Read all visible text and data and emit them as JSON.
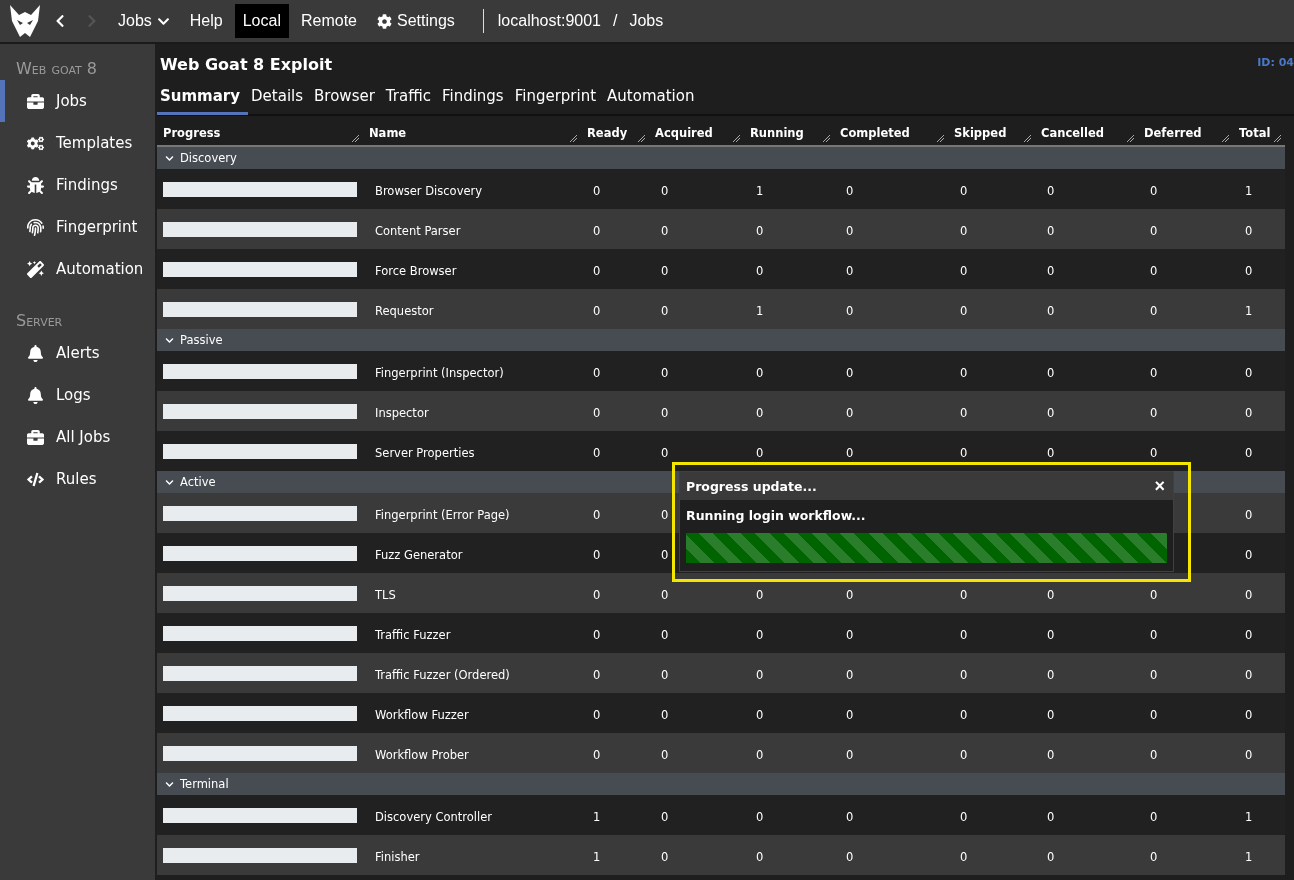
{
  "topbar": {
    "nav": [
      {
        "label": "Jobs",
        "kind": "dropdown",
        "selected": false
      },
      {
        "label": "Help",
        "kind": "plain",
        "selected": false
      },
      {
        "label": "Local",
        "kind": "plain",
        "selected": true
      },
      {
        "label": "Remote",
        "kind": "plain",
        "selected": false
      },
      {
        "label": "Settings",
        "kind": "settings",
        "selected": false
      }
    ],
    "breadcrumb": [
      "localhost:9001",
      "/",
      "Jobs"
    ]
  },
  "sidebar": {
    "sections": [
      {
        "title": "Web goat 8",
        "items": [
          {
            "label": "Jobs",
            "selected": true
          },
          {
            "label": "Templates",
            "selected": false
          },
          {
            "label": "Findings",
            "selected": false
          },
          {
            "label": "Fingerprint",
            "selected": false
          },
          {
            "label": "Automation",
            "selected": false
          }
        ]
      },
      {
        "title": "Server",
        "items": [
          {
            "label": "Alerts",
            "selected": false
          },
          {
            "label": "Logs",
            "selected": false
          },
          {
            "label": "All Jobs",
            "selected": false
          },
          {
            "label": "Rules",
            "selected": false
          }
        ]
      }
    ]
  },
  "page": {
    "title": "Web Goat 8 Exploit",
    "id": "ID: 04"
  },
  "tabs": [
    {
      "label": "Summary",
      "selected": true
    },
    {
      "label": "Details",
      "selected": false
    },
    {
      "label": "Browser",
      "selected": false
    },
    {
      "label": "Traffic",
      "selected": false
    },
    {
      "label": "Findings",
      "selected": false
    },
    {
      "label": "Fingerprint",
      "selected": false
    },
    {
      "label": "Automation",
      "selected": false
    }
  ],
  "table": {
    "columns": [
      "Progress",
      "Name",
      "Ready",
      "Acquired",
      "Running",
      "Completed",
      "Skipped",
      "Cancelled",
      "Deferred",
      "Total"
    ],
    "groups": [
      {
        "title": "Discovery",
        "rows": [
          {
            "level": 0,
            "name": "Browser Discovery",
            "ready": "0",
            "acquired": "0",
            "running": "1",
            "completed": "0",
            "skipped": "0",
            "cancelled": "0",
            "deferred": "0",
            "total": "1"
          },
          {
            "level": 0,
            "name": "Content Parser",
            "ready": "0",
            "acquired": "0",
            "running": "0",
            "completed": "0",
            "skipped": "0",
            "cancelled": "0",
            "deferred": "0",
            "total": "0"
          },
          {
            "level": 0,
            "name": "Force Browser",
            "ready": "0",
            "acquired": "0",
            "running": "0",
            "completed": "0",
            "skipped": "0",
            "cancelled": "0",
            "deferred": "0",
            "total": "0"
          },
          {
            "level": 0,
            "name": "Requestor",
            "ready": "0",
            "acquired": "0",
            "running": "1",
            "completed": "0",
            "skipped": "0",
            "cancelled": "0",
            "deferred": "0",
            "total": "1"
          }
        ]
      },
      {
        "title": "Passive",
        "rows": [
          {
            "level": 0,
            "name": "Fingerprint (Inspector)",
            "ready": "0",
            "acquired": "0",
            "running": "0",
            "completed": "0",
            "skipped": "0",
            "cancelled": "0",
            "deferred": "0",
            "total": "0"
          },
          {
            "level": 0,
            "name": "Inspector",
            "ready": "0",
            "acquired": "0",
            "running": "0",
            "completed": "0",
            "skipped": "0",
            "cancelled": "0",
            "deferred": "0",
            "total": "0"
          },
          {
            "level": 0,
            "name": "Server Properties",
            "ready": "0",
            "acquired": "0",
            "running": "0",
            "completed": "0",
            "skipped": "0",
            "cancelled": "0",
            "deferred": "0",
            "total": "0"
          }
        ]
      },
      {
        "title": "Active",
        "rows": [
          {
            "level": 0,
            "name": "Fingerprint (Error Page)",
            "ready": "0",
            "acquired": "0",
            "total": "0"
          },
          {
            "level": 0,
            "name": "Fuzz Generator",
            "ready": "0",
            "acquired": "0",
            "total": "0"
          },
          {
            "level": 0,
            "name": "TLS",
            "ready": "0",
            "acquired": "0",
            "running": "0",
            "completed": "0",
            "skipped": "0",
            "cancelled": "0",
            "deferred": "0",
            "total": "0"
          },
          {
            "level": 0,
            "name": "Traffic Fuzzer",
            "ready": "0",
            "acquired": "0",
            "running": "0",
            "completed": "0",
            "skipped": "0",
            "cancelled": "0",
            "deferred": "0",
            "total": "0"
          },
          {
            "level": 0,
            "name": "Traffic Fuzzer (Ordered)",
            "ready": "0",
            "acquired": "0",
            "running": "0",
            "completed": "0",
            "skipped": "0",
            "cancelled": "0",
            "deferred": "0",
            "total": "0"
          },
          {
            "level": 0,
            "name": "Workflow Fuzzer",
            "ready": "0",
            "acquired": "0",
            "running": "0",
            "completed": "0",
            "skipped": "0",
            "cancelled": "0",
            "deferred": "0",
            "total": "0"
          },
          {
            "level": 0,
            "name": "Workflow Prober",
            "ready": "0",
            "acquired": "0",
            "running": "0",
            "completed": "0",
            "skipped": "0",
            "cancelled": "0",
            "deferred": "0",
            "total": "0"
          }
        ]
      },
      {
        "title": "Terminal",
        "rows": [
          {
            "level": 0,
            "name": "Discovery Controller",
            "ready": "1",
            "acquired": "0",
            "running": "0",
            "completed": "0",
            "skipped": "0",
            "cancelled": "0",
            "deferred": "0",
            "total": "1"
          },
          {
            "level": 0,
            "name": "Finisher",
            "ready": "1",
            "acquired": "0",
            "running": "0",
            "completed": "0",
            "skipped": "0",
            "cancelled": "0",
            "deferred": "0",
            "total": "1"
          }
        ]
      }
    ]
  },
  "dialog": {
    "title": "Progress update...",
    "close": "×",
    "message": "Running login workflow...",
    "level": 1
  }
}
